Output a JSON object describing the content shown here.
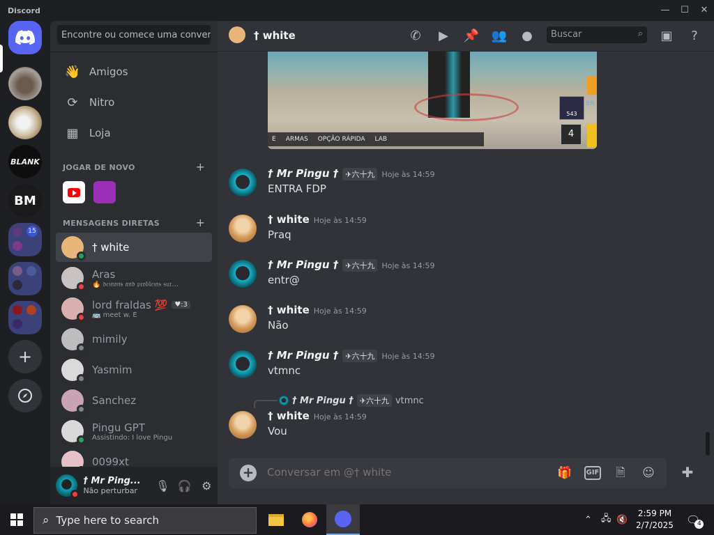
{
  "window": {
    "app_name": "Discord",
    "controls": [
      "—",
      "☐",
      "✕"
    ]
  },
  "servers": [
    {
      "name": "home"
    },
    {
      "name": "server-cat"
    },
    {
      "name": "server-anime"
    },
    {
      "name": "server-blank",
      "label": "BLANK"
    },
    {
      "name": "server-bm",
      "label": "BM"
    },
    {
      "name": "folder-1",
      "badge": "15"
    },
    {
      "name": "folder-2"
    },
    {
      "name": "folder-3"
    }
  ],
  "sidebar": {
    "search_placeholder": "Encontre ou comece uma conver...",
    "nav": [
      {
        "label": "Amigos",
        "icon": "friends-icon"
      },
      {
        "label": "Nitro",
        "icon": "nitro-icon"
      },
      {
        "label": "Loja",
        "icon": "shop-icon"
      }
    ],
    "play_again_header": "JOGAR DE NOVO",
    "dm_header": "MENSAGENS DIRETAS",
    "dms": [
      {
        "name": "† white",
        "sub": "",
        "status": "mobile",
        "avatar_color": "#e9b67a"
      },
      {
        "name": "Aras",
        "sub": "🔥 𝔡𝔢𝔪𝔬𝔫𝔰 𝔞𝔫𝔡 𝔭𝔯𝔬𝔟𝔩𝔢𝔪𝔰 𝔰𝔲𝔯...",
        "status": "dnd",
        "avatar_color": "#c9c2c2"
      },
      {
        "name": "lord fraldas 💯",
        "badge": "♥:3",
        "sub": "🚌 meet w. E",
        "status": "dnd",
        "avatar_color": "#d8b0b0"
      },
      {
        "name": "mimily",
        "sub": "",
        "status": "offline",
        "avatar_color": "#bdbdbd"
      },
      {
        "name": "Yasmim",
        "sub": "",
        "status": "offline",
        "avatar_color": "#dadada"
      },
      {
        "name": "Sanchez",
        "sub": "",
        "status": "offline",
        "avatar_color": "#c8a3b4"
      },
      {
        "name": "Pingu GPT",
        "sub": "Assistindo: I love Pingu",
        "status": "mobile",
        "avatar_color": "#d9d9d9"
      },
      {
        "name": "0099xt",
        "sub": "",
        "status": "offline",
        "avatar_color": "#e6c1c8"
      }
    ]
  },
  "user_panel": {
    "name": "† Mr Ping...",
    "status": "Não perturbar"
  },
  "chat": {
    "title": "† white",
    "search_placeholder": "Buscar",
    "embed_bar": [
      "E",
      "ARMAS",
      "OPÇÃO RÁPIDA",
      "LAB"
    ],
    "embed_badges": [
      "BR",
      "543",
      "4"
    ],
    "messages": [
      {
        "author": "† Mr Pingu †",
        "tag": "✈六十九",
        "time": "Hoje às 14:59",
        "body": "ENTRA FDP",
        "kind": "pingu"
      },
      {
        "author": "† white",
        "tag": "",
        "time": "Hoje às 14:59",
        "body": "Praq",
        "kind": "white"
      },
      {
        "author": "† Mr Pingu †",
        "tag": "✈六十九",
        "time": "Hoje às 14:59",
        "body": "entr@",
        "kind": "pingu"
      },
      {
        "author": "† white",
        "tag": "",
        "time": "Hoje às 14:59",
        "body": "Não",
        "kind": "white"
      },
      {
        "author": "† Mr Pingu †",
        "tag": "✈六十九",
        "time": "Hoje às 14:59",
        "body": "vtmnc",
        "kind": "pingu"
      },
      {
        "author": "† white",
        "tag": "",
        "time": "Hoje às 14:59",
        "body": "Vou",
        "kind": "white",
        "reply": {
          "author": "† Mr Pingu †",
          "tag": "✈六十九",
          "text": "vtmnc"
        }
      }
    ],
    "composer_placeholder": "Conversar em @† white",
    "gif_label": "GIF"
  },
  "taskbar": {
    "search_placeholder": "Type here to search",
    "time": "2:59 PM",
    "date": "2/7/2025",
    "notifications": "4"
  }
}
